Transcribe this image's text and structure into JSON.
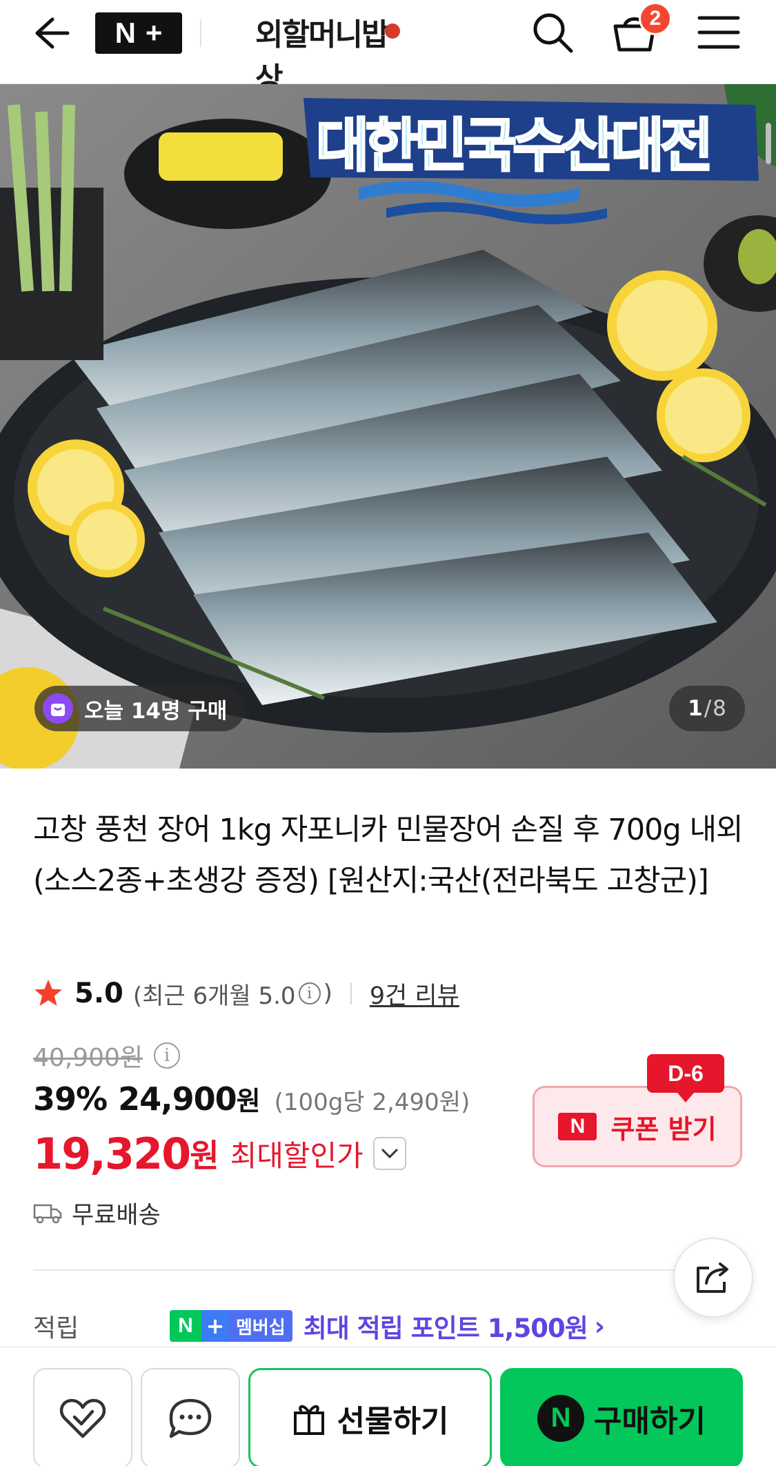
{
  "header": {
    "nplus_n": "N",
    "nplus_plus": "+",
    "brand_logo": "외할머니밥상",
    "cart_count": "2"
  },
  "hero": {
    "banner_text": "대한민국수산대전",
    "buyers_today": "오늘 14명 구매",
    "page_current": "1",
    "page_separator": "/",
    "page_total": "8"
  },
  "product": {
    "title": "고창 풍천 장어 1kg 자포니카 민물장어 손질 후 700g 내외 (소스2종+초생강 증정) [원산지:국산(전라북도 고창군)]",
    "rating": "5.0",
    "recent_prefix": "(최근 6개월 5.0",
    "recent_suffix": ")",
    "info_glyph": "i",
    "review_link": "9건 리뷰",
    "original_price": "40,900원",
    "discount": "39%",
    "sale_price": "24,900",
    "sale_unit": "원",
    "unit_price": "(100g당 2,490원)",
    "max_price": "19,320",
    "max_unit": "원",
    "max_label": "최대할인가",
    "shipping": "무료배송"
  },
  "coupon": {
    "badge": "D-6",
    "n_mark": "N",
    "label": "쿠폰 받기"
  },
  "points": {
    "label": "적립",
    "badge_n": "N",
    "badge_plus": "+",
    "badge_text": "멤버십",
    "text": "최대 적립 포인트 1,500원",
    "chevron": "›"
  },
  "bottom_bar": {
    "gift_label": "선물하기",
    "buy_n": "N",
    "buy_label": "구매하기"
  },
  "colors": {
    "naver_green": "#03c75a",
    "sale_red": "#e6162c",
    "points_purple": "#5b47e0",
    "badge_orange": "#f5472f"
  },
  "icons": [
    "back-arrow-icon",
    "search-icon",
    "cart-icon",
    "menu-icon",
    "purchase-bag-icon",
    "star-icon",
    "info-icon",
    "chevron-down-icon",
    "truck-icon",
    "share-icon",
    "heart-check-icon",
    "chat-bubble-icon",
    "gift-icon"
  ]
}
